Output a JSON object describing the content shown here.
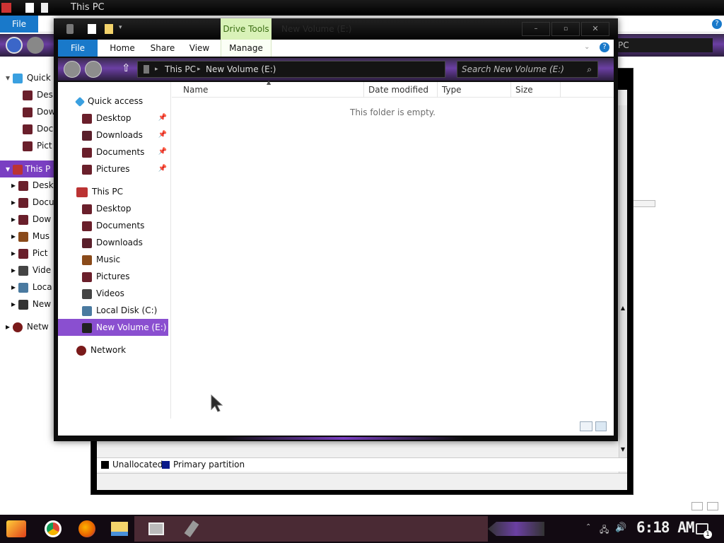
{
  "background_window": {
    "title": "This PC",
    "file_tab": "File",
    "search_fragment": "PC",
    "nav": {
      "quick_access": "Quick",
      "quick_items": [
        "Desk",
        "Dow",
        "Doc",
        "Pict"
      ],
      "this_pc": "This P",
      "pc_items": [
        "Desk",
        "Docu",
        "Dow",
        "Mus",
        "Pict",
        "Vide",
        "Loca",
        "New"
      ],
      "network": "Netw"
    }
  },
  "disk_mgmt": {
    "legend": [
      {
        "label": "Unallocated",
        "color": "#000000"
      },
      {
        "label": "Primary partition",
        "color": "#0a1a8a"
      }
    ]
  },
  "explorer": {
    "title": "New Volume (E:)",
    "contextual_tab": "Drive Tools",
    "ribbon_tabs": [
      "File",
      "Home",
      "Share",
      "View",
      "Manage"
    ],
    "breadcrumb": [
      "This PC",
      "New Volume (E:)"
    ],
    "search_placeholder": "Search New Volume (E:)",
    "nav": {
      "quick_access": "Quick access",
      "quick_items": [
        "Desktop",
        "Downloads",
        "Documents",
        "Pictures"
      ],
      "this_pc": "This PC",
      "pc_items": [
        "Desktop",
        "Documents",
        "Downloads",
        "Music",
        "Pictures",
        "Videos",
        "Local Disk (C:)",
        "New Volume (E:)"
      ],
      "network": "Network"
    },
    "columns": [
      "Name",
      "Date modified",
      "Type",
      "Size"
    ],
    "empty_message": "This folder is empty."
  },
  "taskbar": {
    "clock": "6:18 AM",
    "notification_count": "1"
  },
  "colors": {
    "accent_purple": "#7a3fc2",
    "selection_purple": "#8a4fd0",
    "ribbon_blue": "#1979ca",
    "drive_tools_green": "#d9f2b8"
  }
}
